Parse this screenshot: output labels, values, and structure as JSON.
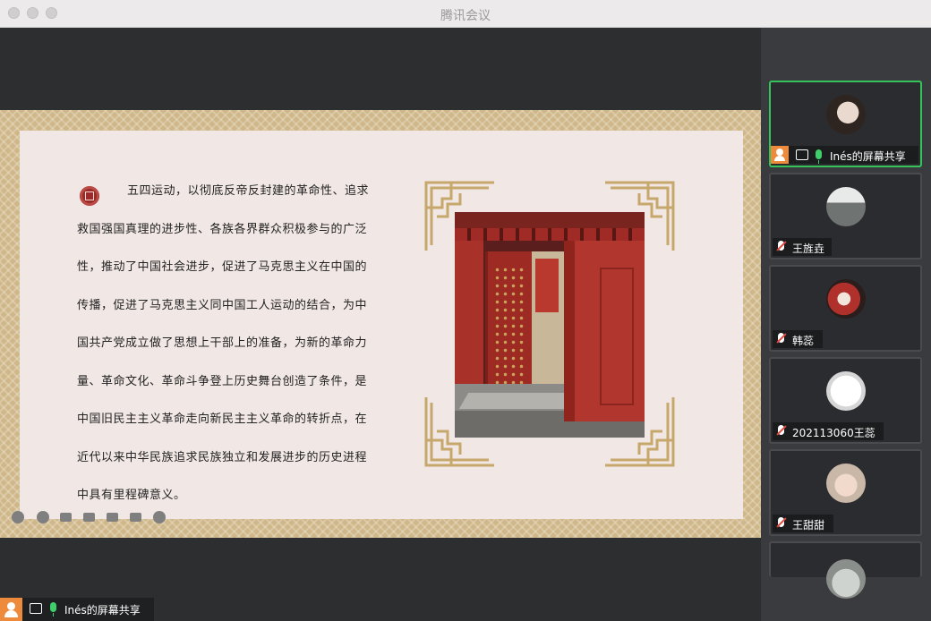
{
  "window": {
    "title": "腾讯会议"
  },
  "slide": {
    "paragraph_lines": [
      "五四运动，以彻底反帝反封建的革命性、追求",
      "救国强国真理的进步性、各族各界群众积极参与的广泛",
      "性，推动了中国社会进步，促进了马克思主义在中国的",
      "传播，促进了马克思主义同中国工人运动的结合，为中",
      "国共产党成立做了思想上干部上的准备，为新的革命力",
      "量、革命文化、革命斗争登上历史舞台创造了条件，是",
      "中国旧民主主义革命走向新民主主义革命的转折点，在",
      "近代以来中华民族追求民族独立和发展进步的历史进程",
      "中具有里程碑意义。"
    ]
  },
  "presenter_badge": {
    "label": "Inés的屏幕共享"
  },
  "participants": [
    {
      "name": "Inés的屏幕共享",
      "active": true,
      "sharing": true
    },
    {
      "name": "王旌垚",
      "muted": true
    },
    {
      "name": "韩蕊",
      "muted": true
    },
    {
      "name": "202113060王蕊",
      "muted": true
    },
    {
      "name": "王甜甜",
      "muted": true
    }
  ],
  "colors": {
    "active_border": "#35c35b",
    "mic_on": "#3fcf6a",
    "presenter_accent": "#ee8a3c"
  }
}
